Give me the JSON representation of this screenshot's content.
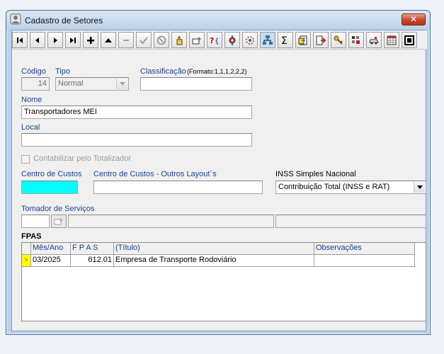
{
  "window": {
    "title": "Cadastro de Setores",
    "close_label": "✕"
  },
  "toolbar": {
    "buttons": [
      {
        "name": "first-record-button",
        "icon": "first-icon"
      },
      {
        "name": "prior-record-button",
        "icon": "prior-icon"
      },
      {
        "name": "next-record-button",
        "icon": "next-icon"
      },
      {
        "name": "last-record-button",
        "icon": "last-icon"
      },
      {
        "name": "insert-button",
        "icon": "plus-icon"
      },
      {
        "name": "delete-button",
        "icon": "up-triangle-icon"
      },
      {
        "name": "edit-button",
        "icon": "minus-icon"
      },
      {
        "name": "post-button",
        "icon": "check-icon"
      },
      {
        "name": "cancel-button",
        "icon": "cancel-icon"
      },
      {
        "name": "refresh-button",
        "icon": "hand-icon"
      },
      {
        "name": "search-button",
        "icon": "search-field-icon"
      },
      {
        "name": "help-button",
        "icon": "help-icon"
      },
      {
        "name": "tools-button",
        "icon": "gear-icon"
      },
      {
        "name": "wizard-button",
        "icon": "wizard-icon"
      },
      {
        "name": "network-button",
        "icon": "network-icon"
      },
      {
        "name": "sum-button",
        "icon": "sum-icon"
      },
      {
        "name": "report-button",
        "icon": "document-icon"
      },
      {
        "name": "export-button",
        "icon": "export-icon"
      },
      {
        "name": "keys-button",
        "icon": "key-icon"
      },
      {
        "name": "permissions-button",
        "icon": "user-grid-icon"
      },
      {
        "name": "transfer-button",
        "icon": "car-icon"
      },
      {
        "name": "calendar-button",
        "icon": "calendar-icon"
      },
      {
        "name": "exit-button",
        "icon": "exit-icon"
      }
    ]
  },
  "form": {
    "codigo": {
      "label": "Código",
      "value": "14"
    },
    "tipo": {
      "label": "Tipo",
      "value": "Normal"
    },
    "classificacao": {
      "label": "Classificação",
      "hint": "(Formato:1,1,1,2,2,2)",
      "value": ""
    },
    "nome": {
      "label": "Nome",
      "value": "Transportadores MEI"
    },
    "local": {
      "label": "Local",
      "value": ""
    },
    "contabilizar": {
      "label": "Contabilizar pelo Totalizador",
      "checked": false
    },
    "centro_custos": {
      "label": "Centro de Custos",
      "value": ""
    },
    "centro_custos_outros": {
      "label": "Centro de Custos - Outros Layout´s",
      "value": ""
    },
    "inss": {
      "label": "INSS Simples Nacional",
      "value": "Contribuição Total (INSS e RAT)"
    },
    "tomador": {
      "label": "Tomador de Serviços",
      "code": "",
      "name": "",
      "doc": ""
    }
  },
  "fpas": {
    "title": "FPAS",
    "columns": [
      "Mês/Ano",
      "F P A S",
      "(Título)",
      "Observações"
    ],
    "rows": [
      {
        "mes_ano": "03/2025",
        "fpas": "612.01",
        "titulo": "Empresa de Transporte Rodoviário",
        "obs": ""
      }
    ],
    "current_row_marker": ">"
  }
}
